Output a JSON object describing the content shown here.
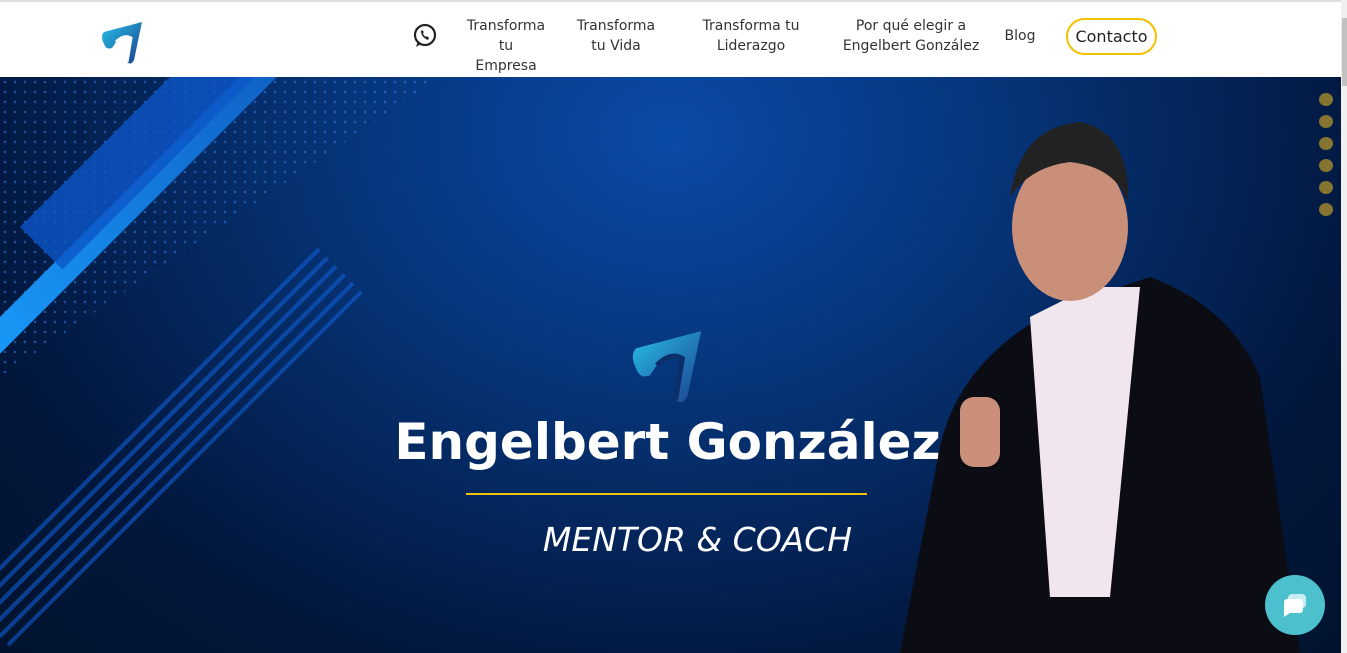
{
  "header": {
    "logo_icon": "brand-logo",
    "whatsapp_icon": "whatsapp-icon",
    "nav": [
      {
        "line1": "Transforma",
        "line2": "tu Empresa"
      },
      {
        "line1": "Transforma",
        "line2": "tu Vida"
      },
      {
        "line1": "Transforma tu",
        "line2": "Liderazgo"
      },
      {
        "line1": "Por qué elegir a",
        "line2": "Engelbert González"
      },
      {
        "line1": "Blog",
        "line2": ""
      }
    ],
    "contact_label": "Contacto"
  },
  "hero": {
    "name": "Engelbert González",
    "subtitle": "MENTOR & COACH",
    "accent": "#f2c200"
  },
  "chat_icon": "chat-bubble-icon"
}
